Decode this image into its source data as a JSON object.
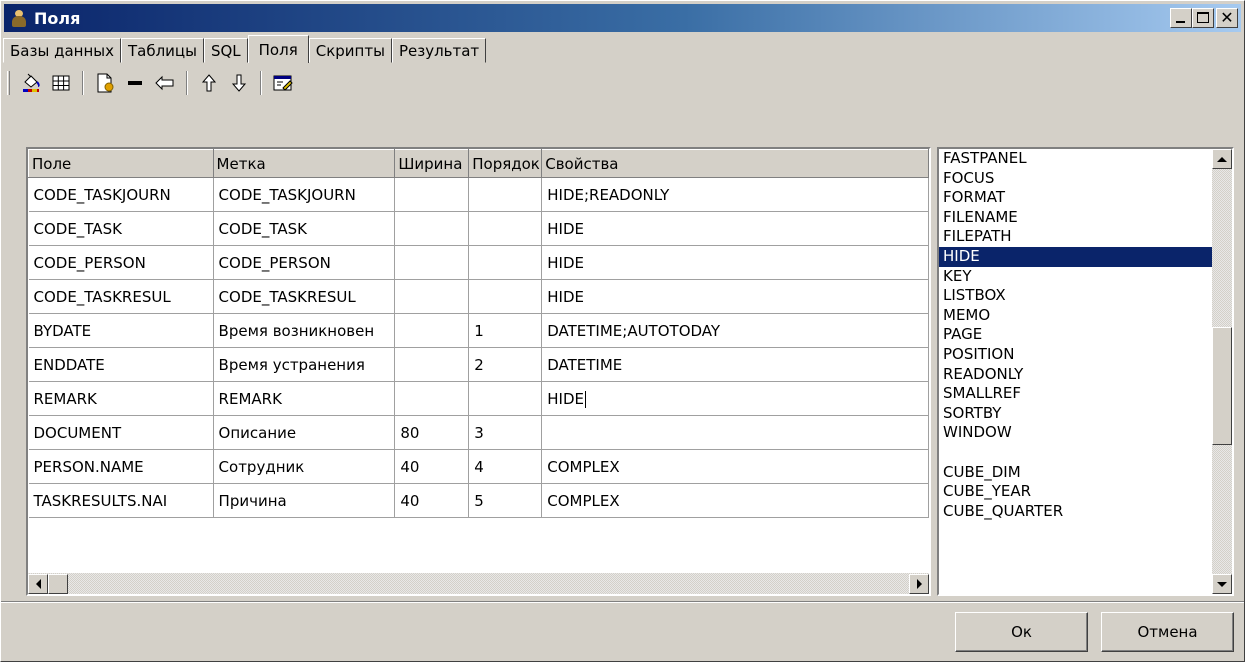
{
  "window": {
    "title": "Поля"
  },
  "tabs": [
    {
      "label": "Базы данных"
    },
    {
      "label": "Таблицы"
    },
    {
      "label": "SQL"
    },
    {
      "label": "Поля",
      "active": true
    },
    {
      "label": "Скрипты"
    },
    {
      "label": "Результат"
    }
  ],
  "toolbar": {
    "icons": [
      "paint-bucket-icon",
      "table-grid-icon",
      "new-document-icon",
      "minus-icon",
      "indent-left-icon",
      "arrow-up-icon",
      "arrow-down-icon",
      "edit-form-icon"
    ]
  },
  "grid": {
    "columns": [
      "Поле",
      "Метка",
      "Ширина",
      "Порядок",
      "Свойства"
    ],
    "rows": [
      {
        "field": "CODE_TASKJOURN",
        "label": "CODE_TASKJOURN",
        "width": "",
        "order": "",
        "props": "HIDE;READONLY"
      },
      {
        "field": "CODE_TASK",
        "label": "CODE_TASK",
        "width": "",
        "order": "",
        "props": "HIDE"
      },
      {
        "field": "CODE_PERSON",
        "label": "CODE_PERSON",
        "width": "",
        "order": "",
        "props": "HIDE"
      },
      {
        "field": "CODE_TASKRESUL",
        "label": "CODE_TASKRESUL",
        "width": "",
        "order": "",
        "props": "HIDE"
      },
      {
        "field": "BYDATE",
        "label": "Время возникновен",
        "width": "",
        "order": "1",
        "props": "DATETIME;AUTOTODAY"
      },
      {
        "field": "ENDDATE",
        "label": "Время устранения",
        "width": "",
        "order": "2",
        "props": "DATETIME"
      },
      {
        "field": "REMARK",
        "label": "REMARK",
        "width": "",
        "order": "",
        "props": "HIDE"
      },
      {
        "field": "DOCUMENT",
        "label": "Описание",
        "width": "80",
        "order": "3",
        "props": ""
      },
      {
        "field": "PERSON.NAME",
        "label": "Сотрудник",
        "width": "40",
        "order": "4",
        "props": "COMPLEX"
      },
      {
        "field": "TASKRESULTS.NAI",
        "label": "Причина",
        "width": "40",
        "order": "5",
        "props": "COMPLEX"
      }
    ],
    "editing_row": 6
  },
  "property_list": {
    "items": [
      "FASTPANEL",
      "FOCUS",
      "FORMAT",
      "FILENAME",
      "FILEPATH",
      "HIDE",
      "KEY",
      "LISTBOX",
      "MEMO",
      "PAGE",
      "POSITION",
      "READONLY",
      "SMALLREF",
      "SORTBY",
      "WINDOW",
      "",
      "CUBE_DIM",
      "CUBE_YEAR",
      "CUBE_QUARTER"
    ],
    "selected": "HIDE"
  },
  "buttons": {
    "ok": "Ок",
    "cancel": "Отмена"
  },
  "colors": {
    "selection": "#0a246a",
    "face": "#d4d0c8",
    "title_start": "#0a246a",
    "title_end": "#a6caf0"
  }
}
